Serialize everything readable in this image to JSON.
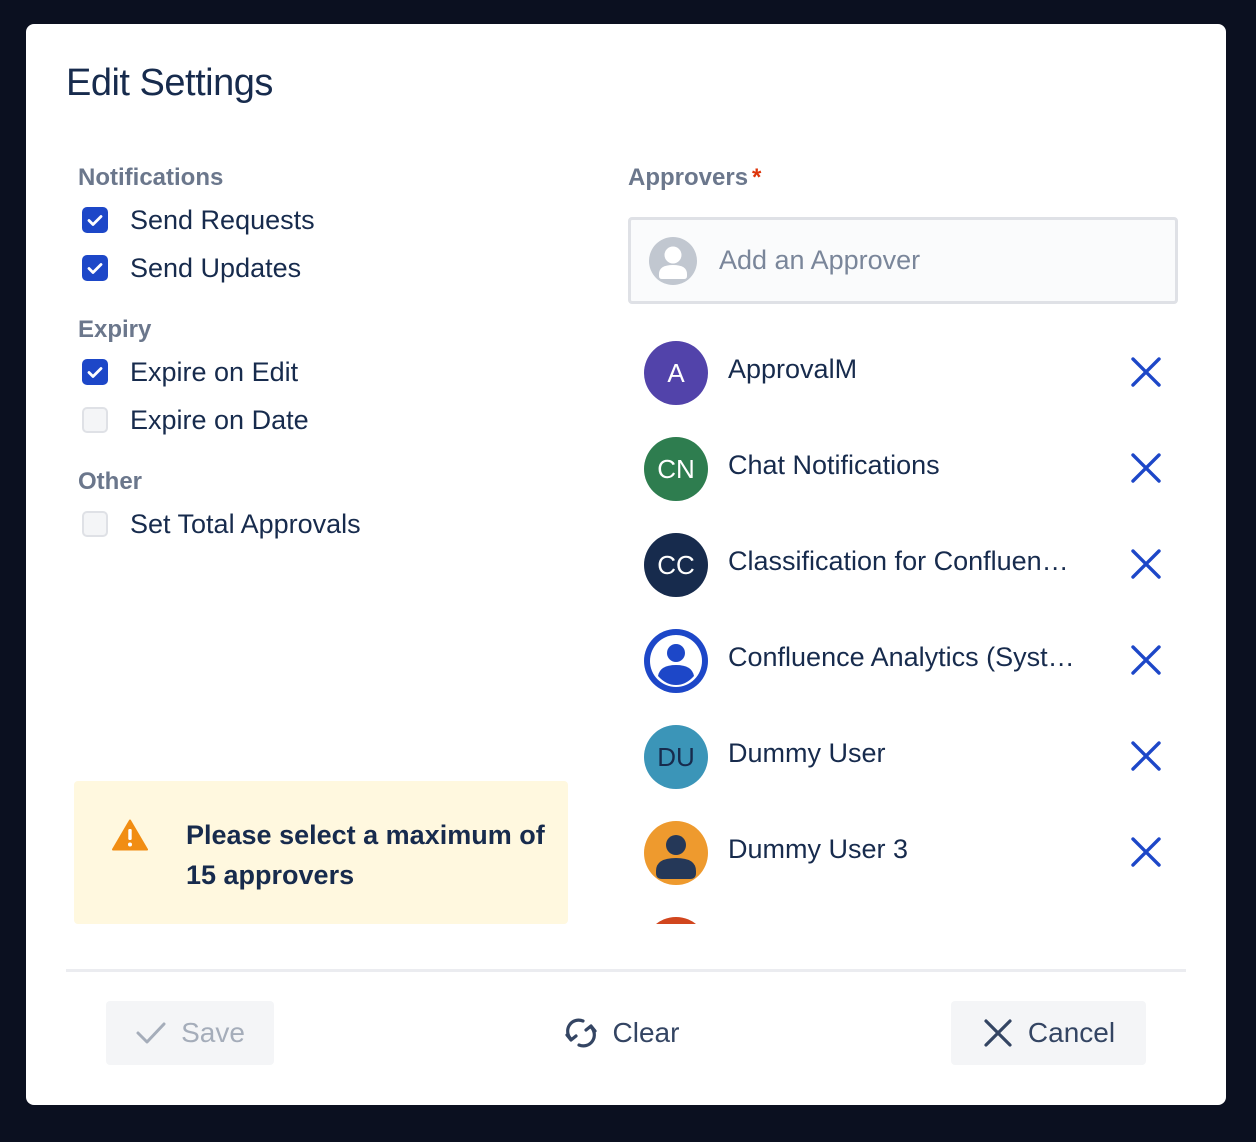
{
  "dialog": {
    "title": "Edit Settings"
  },
  "notifications": {
    "label": "Notifications",
    "items": [
      {
        "label": "Send Requests",
        "checked": true
      },
      {
        "label": "Send Updates",
        "checked": true
      }
    ]
  },
  "expiry": {
    "label": "Expiry",
    "items": [
      {
        "label": "Expire on Edit",
        "checked": true
      },
      {
        "label": "Expire on Date",
        "checked": false
      }
    ]
  },
  "other": {
    "label": "Other",
    "items": [
      {
        "label": "Set Total Approvals",
        "checked": false
      }
    ]
  },
  "warning": {
    "icon": "warning-icon",
    "text": "Please select a maximum of 15 approvers"
  },
  "approvers": {
    "label": "Approvers",
    "required_marker": "*",
    "input_placeholder": "Add an Approver",
    "list": [
      {
        "initials": "A",
        "name": "ApprovalM",
        "color": "#5243aa"
      },
      {
        "initials": "CN",
        "name": "Chat Notifications",
        "color": "#2e7d4f"
      },
      {
        "initials": "CC",
        "name": "Classification for Confluen…",
        "color": "#172b4d"
      },
      {
        "initials": "",
        "name": "Confluence Analytics (Syst…",
        "color": "#1d47c8"
      },
      {
        "initials": "DU",
        "name": "Dummy User",
        "color": "#3b95b8"
      },
      {
        "initials": "",
        "name": "Dummy User 3",
        "color": "#ee9a2e"
      }
    ]
  },
  "footer": {
    "save": "Save",
    "clear": "Clear",
    "cancel": "Cancel"
  },
  "colors": {
    "accent": "#1d47c8",
    "warning_bg": "#fff8df",
    "warning_icon": "#f18d13",
    "required": "#de350b"
  }
}
